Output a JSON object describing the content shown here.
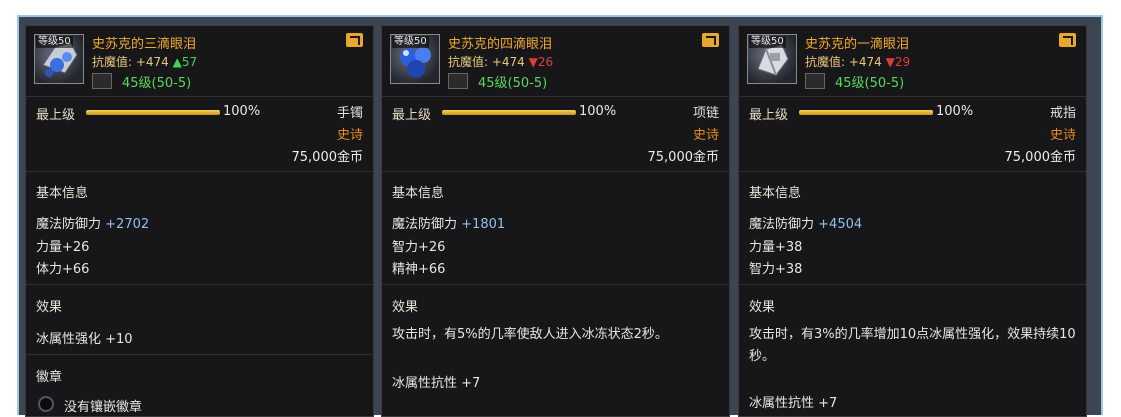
{
  "items": [
    {
      "level_tag": "等级50",
      "name": "史苏克的三滴眼泪",
      "resist_label": "抗魔值: +474",
      "resist_change": "▲57",
      "change_dir": "up",
      "level_range": "45级(50-5)",
      "top_label": "最上级",
      "percent": "100%",
      "percent_value": 100,
      "slot": "手镯",
      "rarity": "史诗",
      "price": "75,000金币",
      "basic_title": "基本信息",
      "basic_stats": [
        {
          "label": "魔法防御力",
          "value": "+2702"
        },
        {
          "label": "力量+26",
          "value": ""
        },
        {
          "label": "体力+66",
          "value": ""
        }
      ],
      "effect_title": "效果",
      "effect_lines": [
        "冰属性强化 +10"
      ],
      "emblem_title": "徽章",
      "emblem_text": "没有镶嵌徽章",
      "icon": "ice-crystal-bracelet-icon"
    },
    {
      "level_tag": "等级50",
      "name": "史苏克的四滴眼泪",
      "resist_label": "抗魔值: +474",
      "resist_change": "▼26",
      "change_dir": "down",
      "level_range": "45级(50-5)",
      "top_label": "最上级",
      "percent": "100%",
      "percent_value": 100,
      "slot": "项链",
      "rarity": "史诗",
      "price": "75,000金币",
      "basic_title": "基本信息",
      "basic_stats": [
        {
          "label": "魔法防御力",
          "value": "+1801"
        },
        {
          "label": "智力+26",
          "value": ""
        },
        {
          "label": "精神+66",
          "value": ""
        }
      ],
      "effect_title": "效果",
      "effect_lines": [
        "攻击时，有5%的几率使敌人进入冰冻状态2秒。",
        "冰属性抗性 +7"
      ],
      "icon": "blue-orbs-necklace-icon"
    },
    {
      "level_tag": "等级50",
      "name": "史苏克的一滴眼泪",
      "resist_label": "抗魔值: +474",
      "resist_change": "▼29",
      "change_dir": "down",
      "level_range": "45级(50-5)",
      "top_label": "最上级",
      "percent": "100%",
      "percent_value": 100,
      "slot": "戒指",
      "rarity": "史诗",
      "price": "75,000金币",
      "basic_title": "基本信息",
      "basic_stats": [
        {
          "label": "魔法防御力",
          "value": "+4504"
        },
        {
          "label": "力量+38",
          "value": ""
        },
        {
          "label": "智力+38",
          "value": ""
        }
      ],
      "effect_title": "效果",
      "effect_lines": [
        "攻击时，有3%的几率增加10点冰属性强化，效果持续10秒。",
        "冰属性抗性 +7"
      ],
      "icon": "silver-ring-icon"
    }
  ],
  "colors": {
    "name": "#f0a930",
    "rarity": "#e88b1e",
    "level_range": "#58d85b",
    "stat_value": "#8fc0f0",
    "up": "#48d34e",
    "down": "#e23b3b"
  }
}
